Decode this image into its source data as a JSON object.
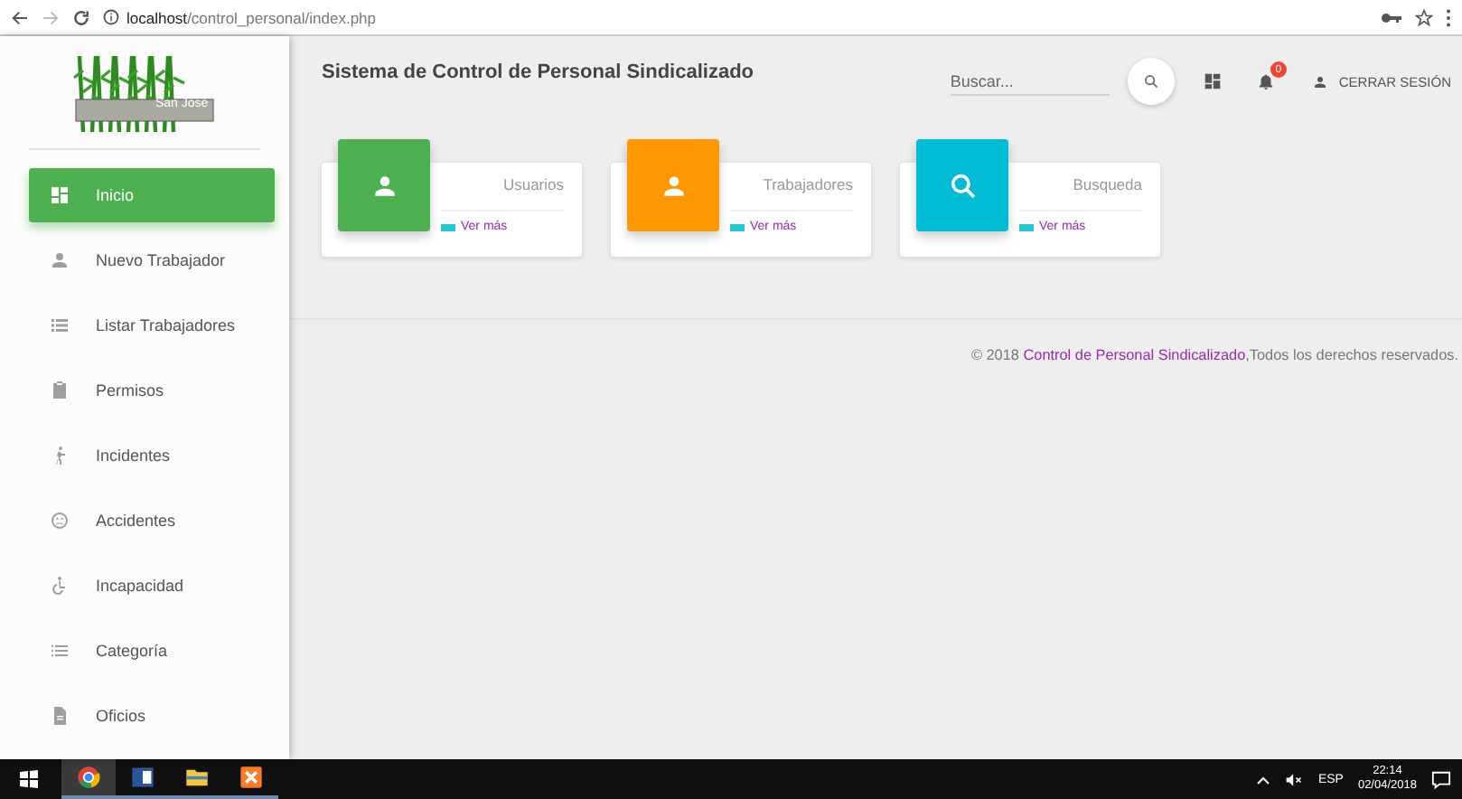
{
  "browser": {
    "url": "**localhost**/control_personal/index.php"
  },
  "logo": {
    "caption": "San José"
  },
  "sidebar": {
    "items": [
      {
        "label": "Inicio",
        "selected": true
      },
      {
        "label": "Nuevo Trabajador",
        "selected": false
      },
      {
        "label": "Listar Trabajadores",
        "selected": false
      },
      {
        "label": "Permisos",
        "selected": false
      },
      {
        "label": "Incidentes",
        "selected": false
      },
      {
        "label": "Accidentes",
        "selected": false
      },
      {
        "label": "Incapacidad",
        "selected": false
      },
      {
        "label": "Categoría",
        "selected": false
      },
      {
        "label": "Oficios",
        "selected": false
      }
    ]
  },
  "header": {
    "title": "Sistema de Control de Personal Sindicalizado",
    "search_placeholder": "Buscar...",
    "notification_count": "0",
    "logout": "CERRAR SESIÓN"
  },
  "cards": [
    {
      "title": "Usuarios",
      "link": "Ver más",
      "color": "#4caf50"
    },
    {
      "title": "Trabajadores",
      "link": "Ver más",
      "color": "#ff9800"
    },
    {
      "title": "Busqueda",
      "link": "Ver más",
      "color": "#00bcd4"
    }
  ],
  "footer": {
    "prefix": "© 2018 ",
    "link": "Control de Personal Sindicalizado",
    "suffix": ",Todos los derechos reservados."
  },
  "taskbar": {
    "language": "ESP",
    "time": "22:14",
    "date": "02/04/2018"
  }
}
